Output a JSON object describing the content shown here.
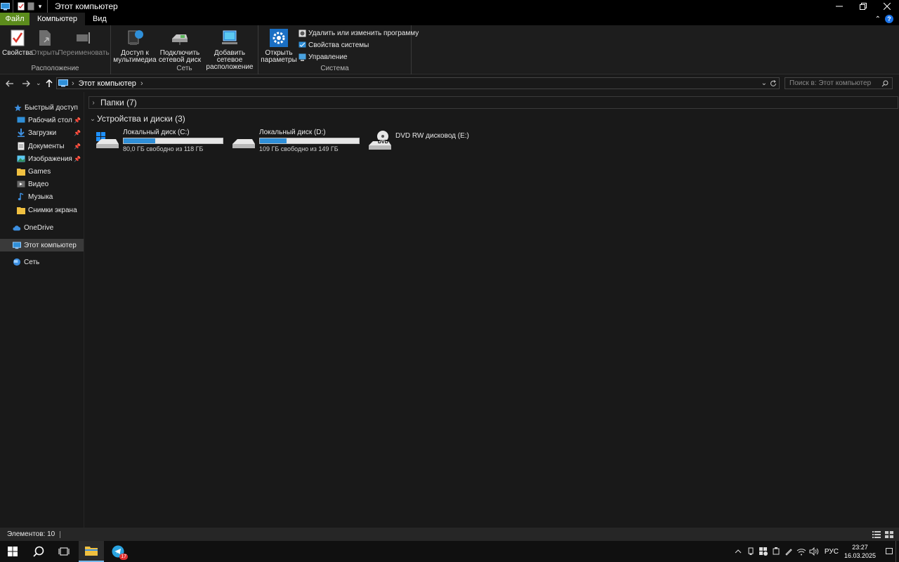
{
  "window": {
    "title": "Этот компьютер"
  },
  "tabs": [
    {
      "label": "Файл"
    },
    {
      "label": "Компьютер"
    },
    {
      "label": "Вид"
    }
  ],
  "ribbon": {
    "location": {
      "label": "Расположение",
      "properties": "Свойства",
      "open": "Открыть",
      "rename": "Переименовать"
    },
    "network": {
      "label": "Сеть",
      "media_line1": "Доступ к",
      "media_line2": "мультимедиа",
      "map_line1": "Подключить",
      "map_line2": "сетевой диск",
      "add_line1": "Добавить сетевое",
      "add_line2": "расположение"
    },
    "system": {
      "label": "Система",
      "settings_line1": "Открыть",
      "settings_line2": "параметры",
      "uninstall": "Удалить или изменить программу",
      "sysprops": "Свойства системы",
      "manage": "Управление"
    }
  },
  "address": {
    "path": "Этот компьютер",
    "search_placeholder": "Поиск в: Этот компьютер"
  },
  "sidebar": {
    "items": [
      {
        "label": "Быстрый доступ",
        "icon": "star-icon"
      },
      {
        "label": "Рабочий стол",
        "icon": "desktop-icon",
        "pinned": true
      },
      {
        "label": "Загрузки",
        "icon": "download-icon",
        "pinned": true
      },
      {
        "label": "Документы",
        "icon": "documents-icon",
        "pinned": true
      },
      {
        "label": "Изображения",
        "icon": "pictures-icon",
        "pinned": true
      },
      {
        "label": "Games",
        "icon": "folder-icon"
      },
      {
        "label": "Видео",
        "icon": "video-icon"
      },
      {
        "label": "Музыка",
        "icon": "music-icon"
      },
      {
        "label": "Снимки экрана",
        "icon": "folder-icon"
      },
      {
        "label": "OneDrive",
        "icon": "cloud-icon"
      },
      {
        "label": "Этот компьютер",
        "icon": "computer-icon",
        "selected": true
      },
      {
        "label": "Сеть",
        "icon": "network-icon"
      }
    ]
  },
  "main": {
    "folders_header": "Папки (7)",
    "devices_header": "Устройства и диски (3)",
    "drives": [
      {
        "name": "Локальный диск (C:)",
        "free_text": "80,0 ГБ свободно из 118 ГБ",
        "used_fraction": 0.32
      },
      {
        "name": "Локальный диск (D:)",
        "free_text": "109 ГБ свободно из 149 ГБ",
        "used_fraction": 0.27
      },
      {
        "name": "DVD RW дисковод (E:)",
        "icon_label": "DVD"
      }
    ]
  },
  "status": {
    "count": "Элементов: 10"
  },
  "taskbar": {
    "lang": "РУС",
    "time": "23:27",
    "date": "16.03.2025",
    "telegram_badge": "17"
  },
  "colors": {
    "accent": "#2f8fd8",
    "file_tab": "#5c8c1c",
    "background": "#191919"
  }
}
